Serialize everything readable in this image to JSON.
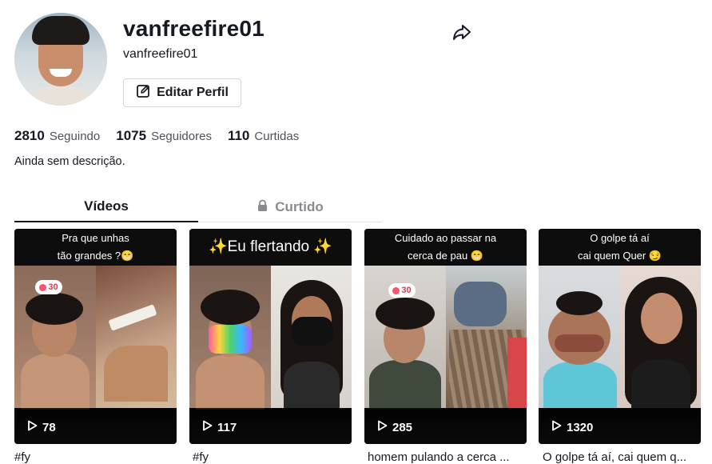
{
  "profile": {
    "username": "vanfreefire01",
    "nickname": "vanfreefire01",
    "edit_label": "Editar Perfil",
    "bio": "Ainda sem descrição."
  },
  "stats": {
    "following_count": "2810",
    "following_label": "Seguindo",
    "followers_count": "1075",
    "followers_label": "Seguidores",
    "likes_count": "110",
    "likes_label": "Curtidas"
  },
  "tabs": {
    "videos_label": "Vídeos",
    "liked_label": "Curtido"
  },
  "videos": [
    {
      "overlay_line1": "Pra que unhas",
      "overlay_line2": "tão grandes ?😁",
      "badge": "30",
      "views": "78",
      "caption": "#fy"
    },
    {
      "overlay_line1": "✨Eu flertando ✨",
      "overlay_line2": "",
      "badge": "",
      "views": "117",
      "caption": "#fy"
    },
    {
      "overlay_line1": "Cuidado ao passar na",
      "overlay_line2": "cerca de pau 😁",
      "badge": "30",
      "views": "285",
      "caption": "homem pulando a cerca ..."
    },
    {
      "overlay_line1": "O golpe tá aí",
      "overlay_line2": "cai quem Quer 😏",
      "badge": "",
      "views": "1320",
      "caption": "O golpe tá aí, cai quem q..."
    }
  ],
  "icons": {
    "share": "share-arrow-icon",
    "edit": "edit-pencil-icon",
    "lock": "lock-icon",
    "play": "play-icon"
  }
}
